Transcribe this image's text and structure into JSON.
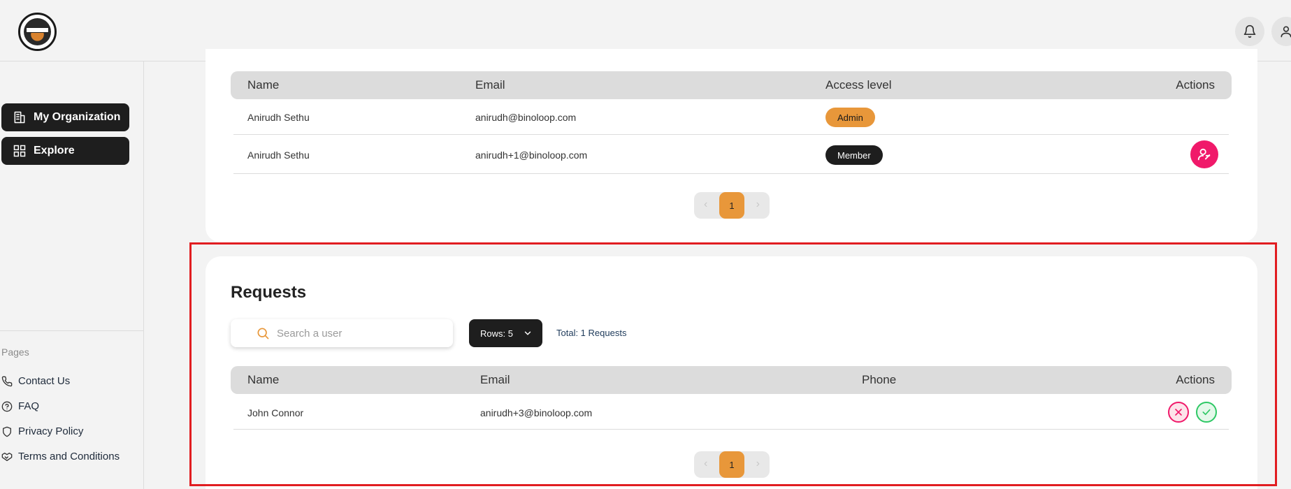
{
  "header": {
    "logo_alt": "organization logo",
    "icons": [
      "bell-icon",
      "user-icon"
    ]
  },
  "sidebar": {
    "nav": [
      {
        "label": "My Organization",
        "icon": "building-icon"
      },
      {
        "label": "Explore",
        "icon": "grid-icon"
      }
    ],
    "pages_title": "Pages",
    "pages": [
      {
        "label": "Contact Us",
        "icon": "phone-icon"
      },
      {
        "label": "FAQ",
        "icon": "question-icon"
      },
      {
        "label": "Privacy Policy",
        "icon": "shield-icon"
      },
      {
        "label": "Terms and Conditions",
        "icon": "handshake-icon"
      }
    ]
  },
  "members": {
    "columns": {
      "name": "Name",
      "email": "Email",
      "access": "Access level",
      "actions": "Actions"
    },
    "rows": [
      {
        "name": "Anirudh Sethu",
        "email": "anirudh@binoloop.com",
        "access": "Admin"
      },
      {
        "name": "Anirudh Sethu",
        "email": "anirudh+1@binoloop.com",
        "access": "Member"
      }
    ],
    "pagination": {
      "current": "1"
    }
  },
  "requests": {
    "title": "Requests",
    "search_placeholder": "Search a user",
    "rows_label": "Rows: 5",
    "total_label": "Total: 1 Requests",
    "columns": {
      "name": "Name",
      "email": "Email",
      "phone": "Phone",
      "actions": "Actions"
    },
    "rows": [
      {
        "name": "John Connor",
        "email": "anirudh+3@binoloop.com",
        "phone": ""
      }
    ],
    "pagination": {
      "current": "1"
    }
  },
  "colors": {
    "accent": "#e8973a",
    "dark": "#1e1e1e",
    "danger": "#f0196a",
    "success": "#2ec865",
    "highlight": "#e11d21"
  }
}
